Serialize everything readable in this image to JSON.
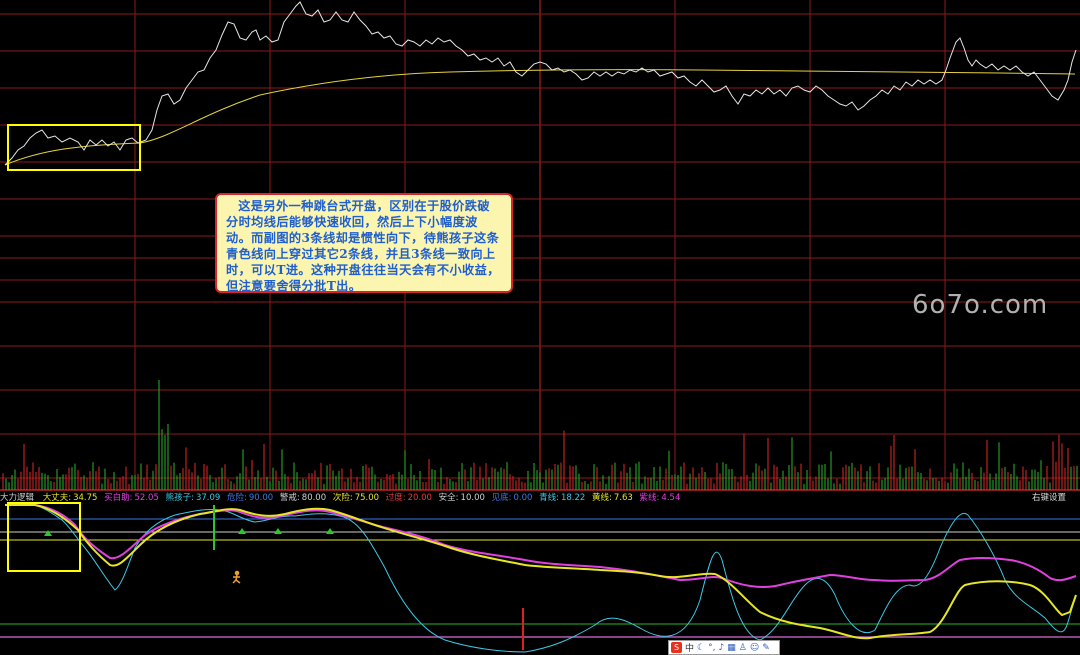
{
  "annotation": {
    "text": "这是另外一种跳台式开盘，区别在于股价跌破分时均线后能够快速收回，然后上下小幅度波动。而副图的3条线却是惯性向下，待熊孩子这条青色线向上穿过其它2条线，并且3条线一致向上时，可以T进。这种开盘往往当天会有不小收益，但注意要舍得分批T出。"
  },
  "watermark": "6o7o.com",
  "indicator_bar": {
    "items": [
      {
        "label": "大力逻辑",
        "value": "",
        "color": "#d0d0d0"
      },
      {
        "label": "大丈夫:",
        "value": "34.75",
        "color": "#e6e626"
      },
      {
        "label": "买白助:",
        "value": "52.05",
        "color": "#e040e0"
      },
      {
        "label": "熊孩子:",
        "value": "37.09",
        "color": "#3cc8e6"
      },
      {
        "label": "危险:",
        "value": "90.00",
        "color": "#3c78e6"
      },
      {
        "label": "警戒:",
        "value": "80.00",
        "color": "#d0d0d0"
      },
      {
        "label": "次险:",
        "value": "75.00",
        "color": "#e6e626"
      },
      {
        "label": "过度:",
        "value": "20.00",
        "color": "#e63c3c"
      },
      {
        "label": "安全:",
        "value": "10.00",
        "color": "#d0d0d0"
      },
      {
        "label": "见底:",
        "value": "0.00",
        "color": "#3c78e6"
      },
      {
        "label": "青线:",
        "value": "18.22",
        "color": "#3cc8e6"
      },
      {
        "label": "黄线:",
        "value": "7.63",
        "color": "#e6e626"
      },
      {
        "label": "紫线:",
        "value": "4.54",
        "color": "#e040e0"
      }
    ],
    "right_setting": "右键设置"
  },
  "tray": {
    "logo": "S",
    "lang": "中",
    "icons": [
      "moon-icon",
      "comma-icon",
      "mic-icon",
      "keyboard-icon",
      "shirt-icon",
      "user-icon",
      "wrench-icon"
    ]
  },
  "colors": {
    "grid": "#8a1a1a",
    "price": "#e6e6e6",
    "avg": "#e6d23c",
    "highlight_box": "#ffff00"
  }
}
